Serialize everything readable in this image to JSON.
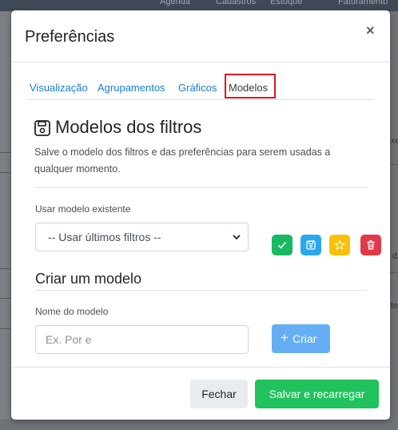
{
  "background": {
    "nav_items": [
      "Agenda",
      "Cadastros",
      "Estoque",
      "Faturamento"
    ],
    "right_fragments": [
      "xo",
      "d",
      "te"
    ]
  },
  "modal": {
    "title": "Preferências",
    "close_label": "×",
    "tabs": [
      {
        "label": "Visualização",
        "active": false
      },
      {
        "label": "Agrupamentos",
        "active": false
      },
      {
        "label": "Gráficos",
        "active": false
      },
      {
        "label": "Modelos",
        "active": true
      }
    ],
    "section": {
      "icon": "save-icon",
      "title": "Modelos dos filtros",
      "description": "Salve o modelo dos filtros e das preferências para serem usadas a qualquer momento."
    },
    "existing": {
      "label": "Usar modelo existente",
      "selected": "-- Usar últimos filtros --",
      "actions": [
        {
          "name": "apply",
          "icon": "check-icon",
          "color": "#19b863"
        },
        {
          "name": "save",
          "icon": "save-icon",
          "color": "#2aa8ee"
        },
        {
          "name": "default",
          "icon": "star-icon",
          "color": "#f9bf0a"
        },
        {
          "name": "delete",
          "icon": "trash-icon",
          "color": "#e0394a"
        }
      ]
    },
    "create": {
      "title": "Criar um modelo",
      "name_label": "Nome do modelo",
      "name_placeholder": "Ex. Por  e",
      "create_button": "Criar",
      "create_icon": "plus-icon"
    },
    "footer": {
      "close_button": "Fechar",
      "save_button": "Salvar e recarregar"
    }
  }
}
